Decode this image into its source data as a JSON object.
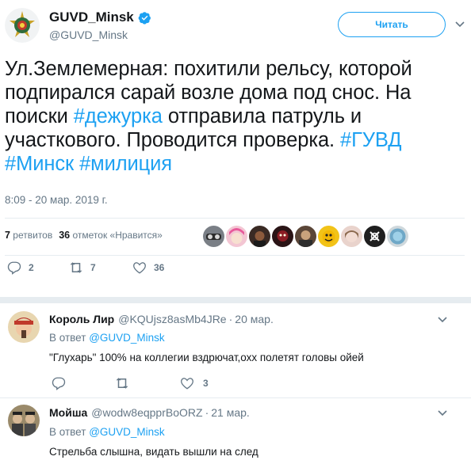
{
  "tweet": {
    "display_name": "GUVD_Minsk",
    "handle": "@GUVD_Minsk",
    "follow_label": "Читать",
    "text_parts": [
      {
        "t": "Ул.Землемерная: похитили рельсу, которой подпирался сарай возле дома под снос. На поиски ",
        "tag": false
      },
      {
        "t": "#дежурка",
        "tag": true
      },
      {
        "t": " отправила патруль и участкового. Проводится проверка. ",
        "tag": false
      },
      {
        "t": "#ГУВД",
        "tag": true
      },
      {
        "t": " ",
        "tag": false
      },
      {
        "t": "#Минск",
        "tag": true
      },
      {
        "t": " ",
        "tag": false
      },
      {
        "t": "#милиция",
        "tag": true
      }
    ],
    "timestamp": "8:09 - 20 мар. 2019 г.",
    "retweets_count": "7",
    "retweets_label": "ретвитов",
    "likes_count": "36",
    "likes_label": "отметок «Нравится»",
    "actions": {
      "replies": "2",
      "retweets": "7",
      "likes": "36"
    }
  },
  "replies": [
    {
      "name": "Король Лир",
      "handle": "@KQUjsz8asMb4JRe",
      "date": "20 мар.",
      "reply_to_prefix": "В ответ",
      "reply_to_handle": "@GUVD_Minsk",
      "text": "\"Глухарь\" 100% на коллегии вздрючат,охх полетят головы ойей",
      "likes": "3"
    },
    {
      "name": "Мойша",
      "handle": "@wodw8eqpprBoORZ",
      "date": "21 мар.",
      "reply_to_prefix": "В ответ",
      "reply_to_handle": "@GUVD_Minsk",
      "text": "Стрельба слышна, видать вышли на след"
    }
  ],
  "colors": {
    "accent": "#1da1f2",
    "text": "#14171a",
    "muted": "#657786",
    "divider": "#e6ecf0"
  }
}
